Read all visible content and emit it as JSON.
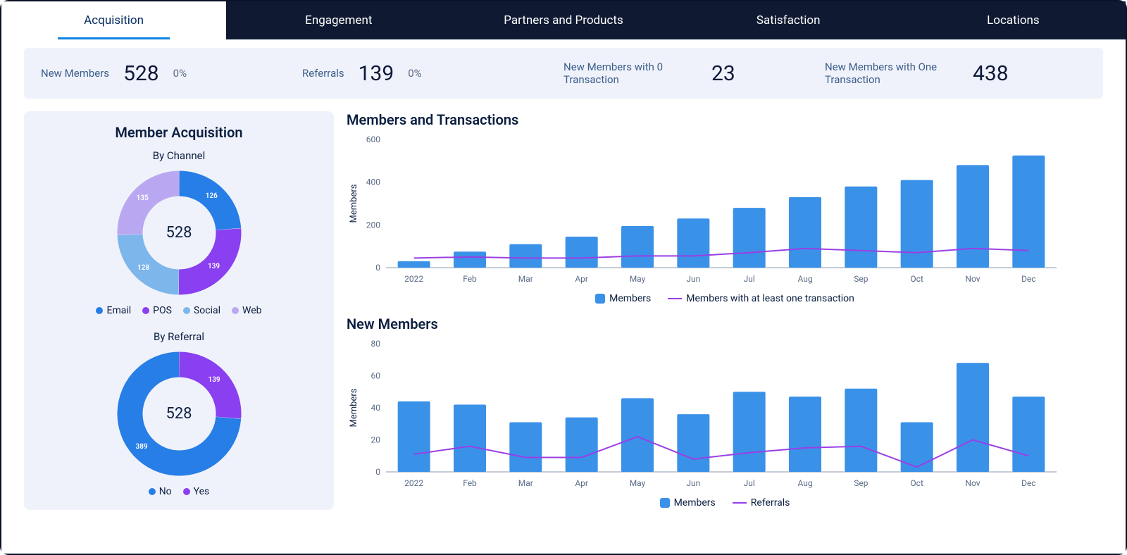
{
  "tabs": [
    "Acquisition",
    "Engagement",
    "Partners and Products",
    "Satisfaction",
    "Locations"
  ],
  "active_tab": 0,
  "kpis": [
    {
      "label": "New Members",
      "value": "528",
      "delta": "0%"
    },
    {
      "label": "Referrals",
      "value": "139",
      "delta": "0%"
    },
    {
      "label": "New Members with 0 Transaction",
      "value": "23",
      "delta": ""
    },
    {
      "label": "New Members with One Transaction",
      "value": "438",
      "delta": ""
    }
  ],
  "left_panel": {
    "title": "Member Acquisition",
    "by_channel_title": "By Channel",
    "by_referral_title": "By Referral",
    "channel_center": "528",
    "referral_center": "528",
    "channel_labels": {
      "email": "126",
      "pos": "139",
      "social": "128",
      "web": "135"
    },
    "referral_labels": {
      "no": "389",
      "yes": "139"
    },
    "channel_legend": [
      "Email",
      "POS",
      "Social",
      "Web"
    ],
    "referral_legend": [
      "No",
      "Yes"
    ]
  },
  "colors": {
    "email": "#267ee6",
    "pos": "#8a3ff0",
    "social": "#7db6eb",
    "web": "#b9a8f1",
    "no": "#267ee6",
    "yes": "#8a3ff0",
    "bar": "#3a91e8",
    "line": "#9a3fe6"
  },
  "chart_data": [
    {
      "title": "Members and Transactions",
      "type": "bar+line",
      "categories": [
        "2022",
        "Feb",
        "Mar",
        "Apr",
        "May",
        "Jun",
        "Jul",
        "Aug",
        "Sep",
        "Oct",
        "Nov",
        "Dec"
      ],
      "ylabel": "Members",
      "ylim": [
        0,
        600
      ],
      "yticks": [
        0,
        200,
        400,
        600
      ],
      "series": [
        {
          "name": "Members",
          "kind": "bar",
          "values": [
            30,
            75,
            110,
            145,
            195,
            230,
            280,
            330,
            380,
            410,
            480,
            525
          ]
        },
        {
          "name": "Members with at least one transaction",
          "kind": "line",
          "values": [
            45,
            50,
            45,
            45,
            55,
            55,
            70,
            90,
            80,
            70,
            90,
            80
          ]
        }
      ]
    },
    {
      "title": "New Members",
      "type": "bar+line",
      "categories": [
        "2022",
        "Feb",
        "Mar",
        "Apr",
        "May",
        "Jun",
        "Jul",
        "Aug",
        "Sep",
        "Oct",
        "Nov",
        "Dec"
      ],
      "ylabel": "Members",
      "ylim": [
        0,
        80
      ],
      "yticks": [
        0,
        20,
        40,
        60,
        80
      ],
      "series": [
        {
          "name": "Members",
          "kind": "bar",
          "values": [
            44,
            42,
            31,
            34,
            46,
            36,
            50,
            47,
            52,
            31,
            68,
            47
          ]
        },
        {
          "name": "Referrals",
          "kind": "line",
          "values": [
            11,
            16,
            9,
            9,
            22,
            8,
            12,
            15,
            16,
            3,
            20,
            10
          ]
        }
      ]
    },
    {
      "title": "Member Acquisition — By Channel",
      "type": "pie",
      "series": [
        {
          "name": "Channel",
          "values": [
            {
              "name": "Email",
              "value": 126,
              "color": "#267ee6"
            },
            {
              "name": "POS",
              "value": 139,
              "color": "#8a3ff0"
            },
            {
              "name": "Social",
              "value": 128,
              "color": "#7db6eb"
            },
            {
              "name": "Web",
              "value": 135,
              "color": "#b9a8f1"
            }
          ]
        }
      ],
      "center": "528"
    },
    {
      "title": "Member Acquisition — By Referral",
      "type": "pie",
      "series": [
        {
          "name": "Referral",
          "values": [
            {
              "name": "No",
              "value": 389,
              "color": "#267ee6"
            },
            {
              "name": "Yes",
              "value": 139,
              "color": "#8a3ff0"
            }
          ]
        }
      ],
      "center": "528"
    }
  ]
}
